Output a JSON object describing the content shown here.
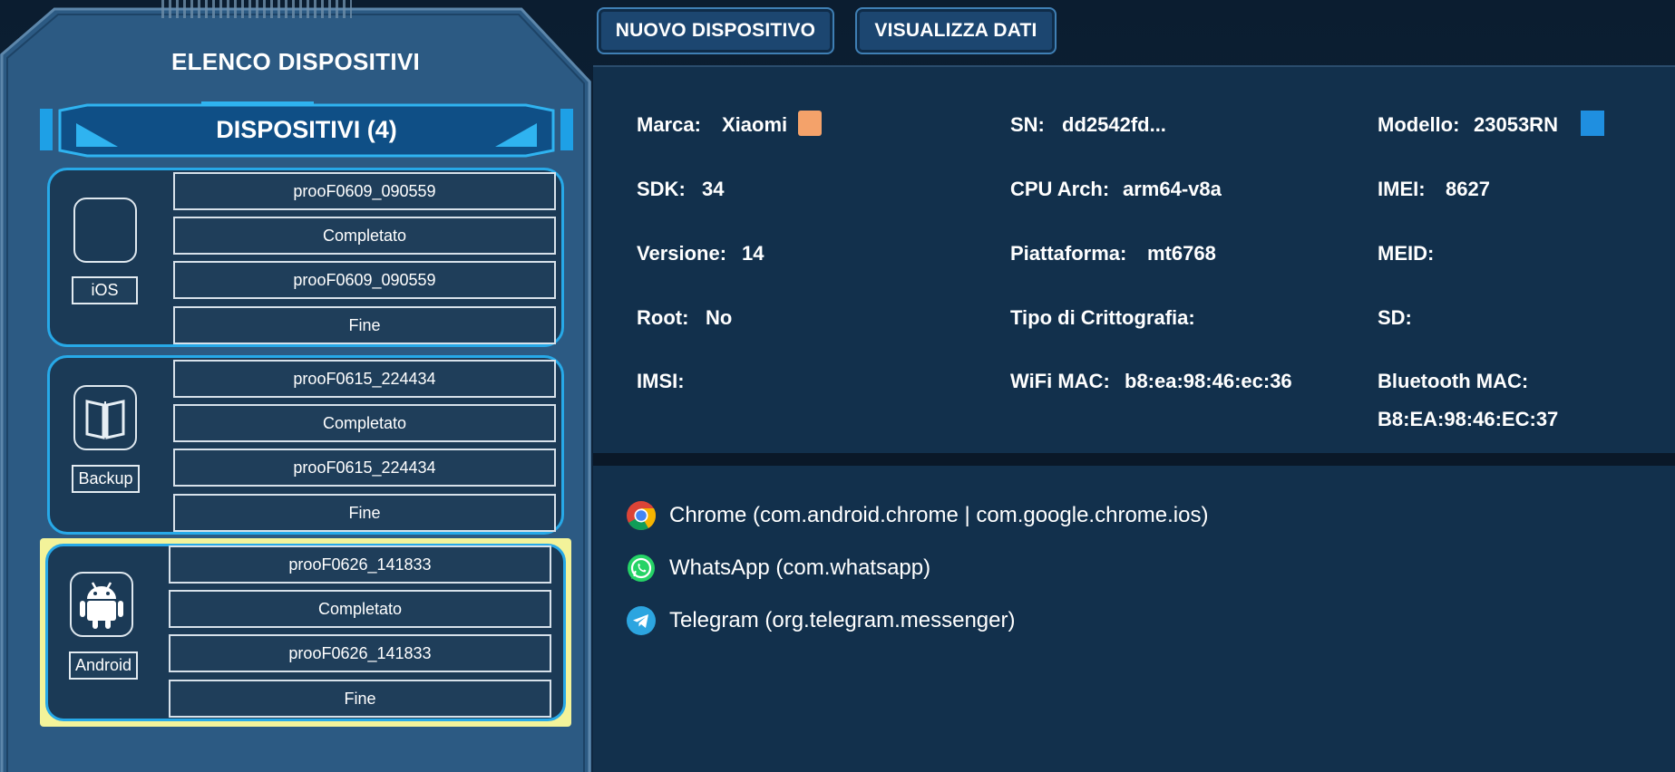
{
  "header": {
    "new_device_button": "NUOVO DISPOSITIVO",
    "view_data_button": "VISUALIZZA DATI"
  },
  "sidebar": {
    "title": "ELENCO DISPOSITIVI",
    "count_label": "DISPOSITIVI (4)",
    "devices": [
      {
        "type": "iOS",
        "icon": "blank-device-icon",
        "rows": [
          "prooF0609_090559",
          "Completato",
          "prooF0609_090559",
          "Fine"
        ],
        "selected": false
      },
      {
        "type": "Backup",
        "icon": "backup-book-icon",
        "rows": [
          "prooF0615_224434",
          "Completato",
          "prooF0615_224434",
          "Fine"
        ],
        "selected": false
      },
      {
        "type": "Android",
        "icon": "android-icon",
        "rows": [
          "prooF0626_141833",
          "Completato",
          "prooF0626_141833",
          "Fine"
        ],
        "selected": true
      }
    ]
  },
  "device_info": {
    "marca_label": "Marca:",
    "marca_value": "Xiaomi",
    "sn_label": "SN:",
    "sn_value": "dd2542fd...",
    "modello_label": "Modello:",
    "modello_value": "23053RN",
    "sdk_label": "SDK:",
    "sdk_value": "34",
    "cpu_label": "CPU Arch:",
    "cpu_value": "arm64-v8a",
    "imei_label": "IMEI:",
    "imei_value": "8627",
    "versione_label": "Versione:",
    "versione_value": "14",
    "piattaforma_label": "Piattaforma:",
    "piattaforma_value": "mt6768",
    "meid_label": "MEID:",
    "root_label": "Root:",
    "root_value": "No",
    "crittografia_label": "Tipo di Crittografia:",
    "sd_label": "SD:",
    "imsi_label": "IMSI:",
    "wifi_label": "WiFi MAC:",
    "wifi_value": "b8:ea:98:46:ec:36",
    "bt_label": "Bluetooth MAC:",
    "bt_value": "B8:EA:98:46:EC:37",
    "marca_color": "#f4a26a",
    "modello_color": "#1f8fe0"
  },
  "apps": [
    {
      "name": "Chrome (com.android.chrome | com.google.chrome.ios)",
      "icon": "chrome-icon"
    },
    {
      "name": "WhatsApp (com.whatsapp)",
      "icon": "whatsapp-icon"
    },
    {
      "name": "Telegram (org.telegram.messenger)",
      "icon": "telegram-icon"
    }
  ],
  "colors": {
    "accent": "#27a9e8",
    "selected_highlight": "#f3f39a",
    "panel": "#2c5a83",
    "info_bg": "#12304c"
  }
}
